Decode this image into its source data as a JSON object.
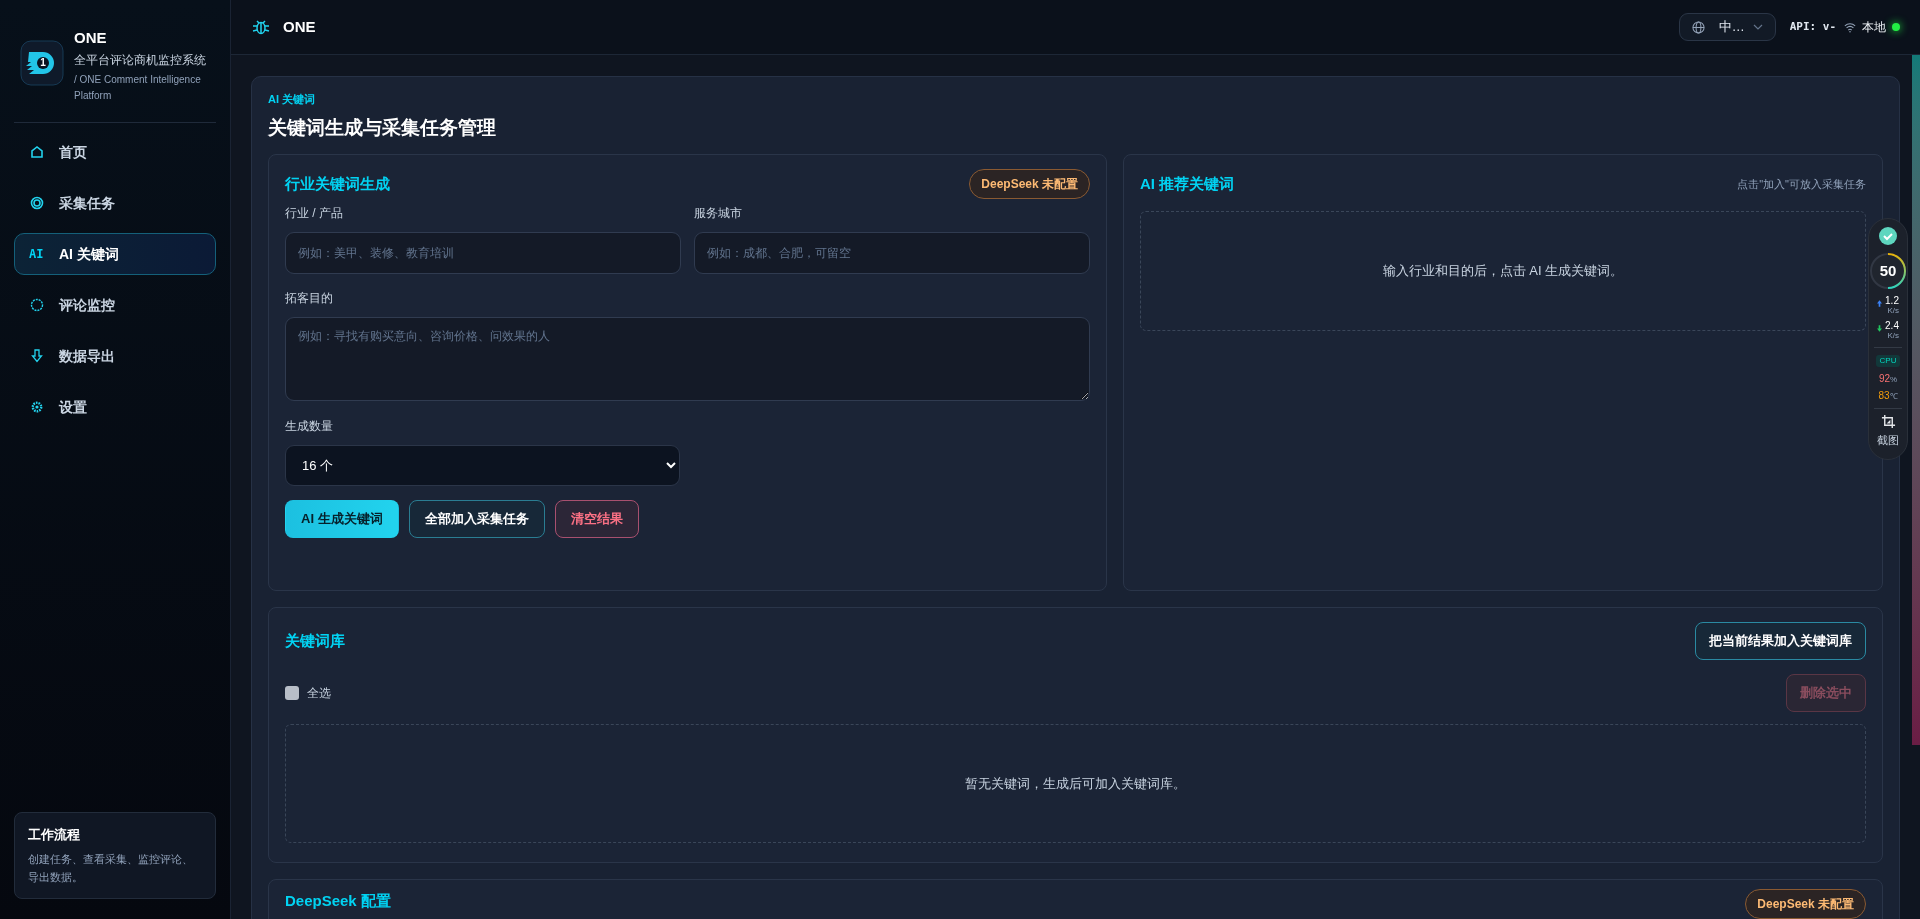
{
  "sidebar": {
    "brand": {
      "logo_mark": "1",
      "name": "ONE",
      "subtitle": "全平台评论商机监控系统",
      "tagline": "/ ONE Comment Intelligence Platform"
    },
    "nav": [
      {
        "kind": "home",
        "label": "首页",
        "selected": false
      },
      {
        "kind": "target",
        "label": "采集任务",
        "selected": false
      },
      {
        "kind": "text",
        "glyph": "AI",
        "label": "AI 关键词",
        "selected": true
      },
      {
        "kind": "circle",
        "label": "评论监控",
        "selected": false
      },
      {
        "kind": "download",
        "label": "数据导出",
        "selected": false
      },
      {
        "kind": "gear",
        "label": "设置",
        "selected": false
      }
    ],
    "workflow": {
      "title": "工作流程",
      "text": "创建任务、查看采集、监控评论、导出数据。"
    }
  },
  "header": {
    "title": "ONE",
    "language": "中…",
    "api": "API: v-",
    "connection": "本地",
    "online": true
  },
  "page": {
    "eyebrow": "AI 关键词",
    "title": "关键词生成与采集任务管理"
  },
  "generator": {
    "title": "行业关键词生成",
    "badge": "DeepSeek 未配置",
    "fields": [
      {
        "label": "行业 / 产品",
        "placeholder": "例如：美甲、装修、教育培训"
      },
      {
        "label": "服务城市",
        "placeholder": "例如：成都、合肥，可留空"
      }
    ],
    "purpose": {
      "label": "拓客目的",
      "placeholder": "例如：寻找有购买意向、咨询价格、问效果的人"
    },
    "count": {
      "label": "生成数量",
      "value": "16 个"
    },
    "buttons": [
      {
        "kind": "primary",
        "label": "AI 生成关键词"
      },
      {
        "kind": "outline",
        "label": "全部加入采集任务"
      },
      {
        "kind": "danger",
        "label": "清空结果"
      }
    ]
  },
  "recommend": {
    "title": "AI 推荐关键词",
    "hint": "点击\"加入\"可放入采集任务",
    "empty": "输入行业和目的后，点击 AI 生成关键词。"
  },
  "library": {
    "title": "关键词库",
    "add_button": "把当前结果加入关键词库",
    "select_all": {
      "label": "全选",
      "checked": false
    },
    "delete_button": {
      "label": "删除选中",
      "disabled": true
    },
    "empty": "暂无关键词，生成后可加入关键词库。"
  },
  "config": {
    "title": "DeepSeek 配置",
    "badge": "DeepSeek 未配置"
  },
  "monitor": {
    "ok": true,
    "score": "50",
    "level": 0.5,
    "upload": "1.2",
    "upload_unit": "K/s",
    "download": "2.4",
    "download_unit": "K/s",
    "cpu_label": "CPU",
    "cpu": "92",
    "cpu_unit": "%",
    "temp": "83",
    "temp_unit": "℃",
    "screenshot": "截图"
  }
}
